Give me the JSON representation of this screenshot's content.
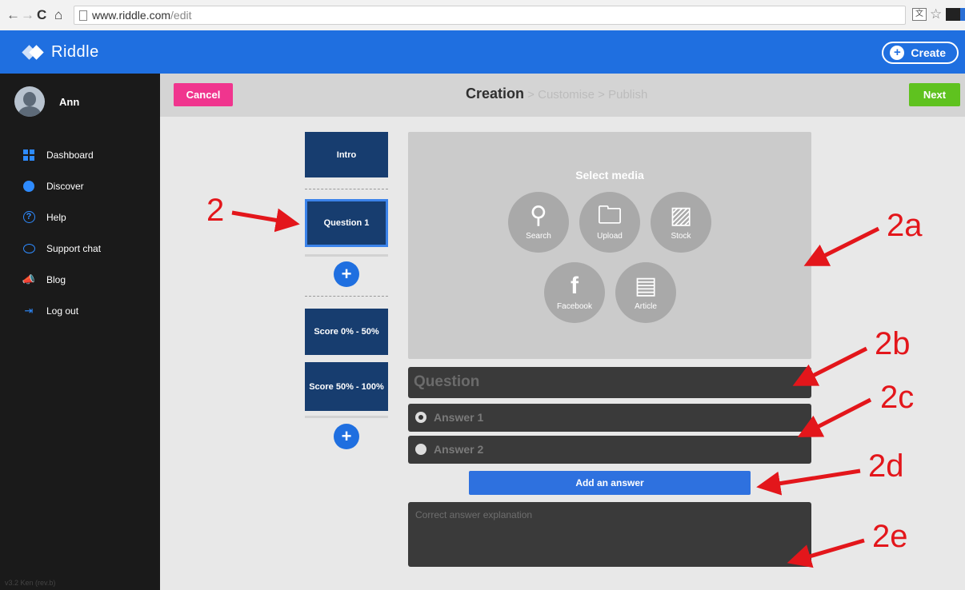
{
  "browser": {
    "url_host": "www.riddle.com",
    "url_path": "/edit",
    "back_glyph": "←",
    "forward_glyph": "→",
    "reload_glyph": "C",
    "home_glyph": "⌂",
    "star_glyph": "☆",
    "translate_glyph": "文"
  },
  "header": {
    "logo_text": "Riddle",
    "create_label": "Create",
    "create_glyph": "+",
    "accent_color": "#1f6fe0"
  },
  "sidebar": {
    "user_name": "Ann",
    "items": [
      {
        "label": "Dashboard",
        "icon": "grid-icon"
      },
      {
        "label": "Discover",
        "icon": "compass-icon"
      },
      {
        "label": "Help",
        "icon": "help-icon"
      },
      {
        "label": "Support chat",
        "icon": "chat-icon"
      },
      {
        "label": "Blog",
        "icon": "megaphone-icon"
      },
      {
        "label": "Log out",
        "icon": "logout-icon"
      }
    ],
    "help_glyph": "?",
    "blog_glyph": "📣",
    "logout_glyph": "⇥",
    "version": "v3.2 Ken (rev.b)"
  },
  "workflow": {
    "cancel_label": "Cancel",
    "next_label": "Next",
    "step_current": "Creation",
    "step_separator": " > ",
    "step_2": "Customise",
    "step_3": "Publish",
    "cancel_color": "#f0358e",
    "next_color": "#5fc21f"
  },
  "slides": {
    "intro": "Intro",
    "question_1": "Question 1",
    "score_low": "Score 0% - 50%",
    "score_high": "Score 50% - 100%",
    "add_glyph": "+"
  },
  "media": {
    "title": "Select media",
    "buttons": [
      {
        "label": "Search",
        "icon": "search-icon",
        "glyph": "⚲"
      },
      {
        "label": "Upload",
        "icon": "upload-icon",
        "glyph": "🗀"
      },
      {
        "label": "Stock",
        "icon": "stock-icon",
        "glyph": "▨"
      },
      {
        "label": "Facebook",
        "icon": "facebook-icon",
        "glyph": "f"
      },
      {
        "label": "Article",
        "icon": "article-icon",
        "glyph": "▤"
      }
    ]
  },
  "editor": {
    "question_placeholder": "Question",
    "answers": [
      "Answer 1",
      "Answer 2"
    ],
    "add_answer_label": "Add an answer",
    "explanation_placeholder": "Correct answer explanation"
  },
  "annotations": {
    "label_2": "2",
    "label_2a": "2a",
    "label_2b": "2b",
    "label_2c": "2c",
    "label_2d": "2d",
    "label_2e": "2e",
    "color": "#e3161b"
  }
}
